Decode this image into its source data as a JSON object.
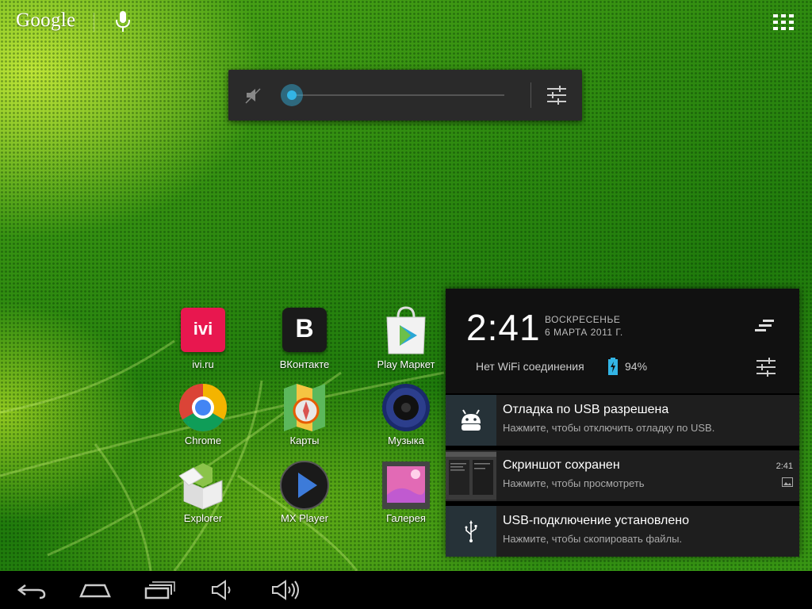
{
  "search": {
    "logo_text": "Google"
  },
  "apps": [
    {
      "label": "ivi.ru",
      "icon": "ivi-icon"
    },
    {
      "label": "ВКонтакте",
      "icon": "vk-icon"
    },
    {
      "label": "Play Маркет",
      "icon": "play-store-icon"
    },
    {
      "label": "Chrome",
      "icon": "chrome-icon"
    },
    {
      "label": "Карты",
      "icon": "maps-icon"
    },
    {
      "label": "Музыка",
      "icon": "music-icon"
    },
    {
      "label": "Explorer",
      "icon": "explorer-icon"
    },
    {
      "label": "MX Player",
      "icon": "mx-player-icon"
    },
    {
      "label": "Галерея",
      "icon": "gallery-icon"
    }
  ],
  "volume": {
    "level": 0,
    "muted": true
  },
  "notifications": {
    "time": "2:41",
    "day": "ВОСКРЕСЕНЬЕ",
    "date": "6 МАРТА 2011 Г.",
    "wifi_status": "Нет WiFi соединения",
    "battery": "94%",
    "items": [
      {
        "title": "Отладка по USB разрешена",
        "subtitle": "Нажмите, чтобы отключить отладку по USB.",
        "icon": "android-debug-icon"
      },
      {
        "title": "Скриншот сохранен",
        "subtitle": "Нажмите, чтобы просмотреть",
        "time": "2:41",
        "icon": "screenshot-thumbnail"
      },
      {
        "title": "USB-подключение установлено",
        "subtitle": "Нажмите, чтобы скопировать файлы.",
        "icon": "usb-icon"
      }
    ]
  },
  "colors": {
    "accent": "#33b5e5",
    "panel": "#1e1e1e",
    "wallpaper": "#2e8a10"
  }
}
